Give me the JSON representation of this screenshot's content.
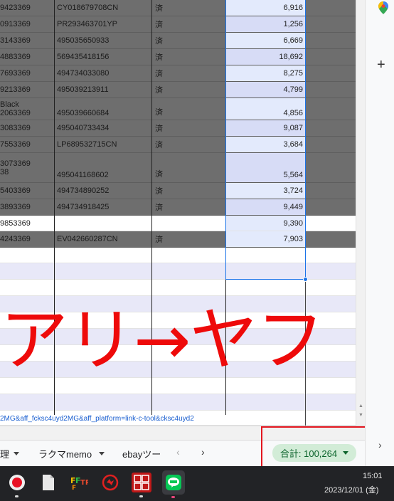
{
  "sheet": {
    "rows": [
      {
        "a": "9423369",
        "b": "CY018679708CN",
        "c": "済",
        "d": "6,916"
      },
      {
        "a": "0913369",
        "b": "PR293463701YP",
        "c": "済",
        "d": "1,256"
      },
      {
        "a": "3143369",
        "b": "495035650933",
        "c": "済",
        "d": "6,669"
      },
      {
        "a": "4883369",
        "b": "569435418156",
        "c": "済",
        "d": "18,692"
      },
      {
        "a": "7693369",
        "b": "494734033080",
        "c": "済",
        "d": "8,275"
      },
      {
        "a": "9213369",
        "b": "495039213911",
        "c": "済",
        "d": "4,799"
      },
      {
        "a": "Black",
        "a2": "2063369",
        "b": "495039660684",
        "c": "済",
        "d": "4,856"
      },
      {
        "a": "3083369",
        "b": "495040733434",
        "c": "済",
        "d": "9,087"
      },
      {
        "a": "7553369",
        "b": "LP689532715CN",
        "c": "済",
        "d": "3,684"
      },
      {
        "a": "3073369",
        "a2": "38",
        "b": "495041168602",
        "c": "済",
        "d": "5,564"
      },
      {
        "a": "5403369",
        "b": "494734890252",
        "c": "済",
        "d": "3,724"
      },
      {
        "a": "3893369",
        "b": "494734918425",
        "c": "済",
        "d": "9,449"
      },
      {
        "a": "9853369",
        "b": "",
        "c": "",
        "d": "9,390"
      },
      {
        "a": "4243369",
        "b": "EV042660287CN",
        "c": "済",
        "d": "7,903"
      }
    ],
    "link_fragment": "2MG&aff_fcksc4uyd2MG&aff_platform=link-c-tool&cksc4uyd2"
  },
  "overlay_text": "アリ→ヤフ",
  "tabs": {
    "tab1": "理",
    "tab2": "ラクマmemo",
    "tab3": "ebayツー",
    "prev": "‹",
    "next": "›"
  },
  "summary": {
    "label": "合計: 100,264"
  },
  "side_panel": {
    "plus": "+",
    "chevron": "›"
  },
  "clock": {
    "time": "15:01",
    "date": "2023/12/01 (金)"
  },
  "taskbar_apps": [
    "screen-recorder",
    "files",
    "ffftp",
    "app-4",
    "shukusho-kakumei",
    "line"
  ],
  "colors": {
    "overlay_red": "#ee0a0a",
    "sum_green": "#d2ecd7",
    "selection_blue": "#1a73e8"
  }
}
